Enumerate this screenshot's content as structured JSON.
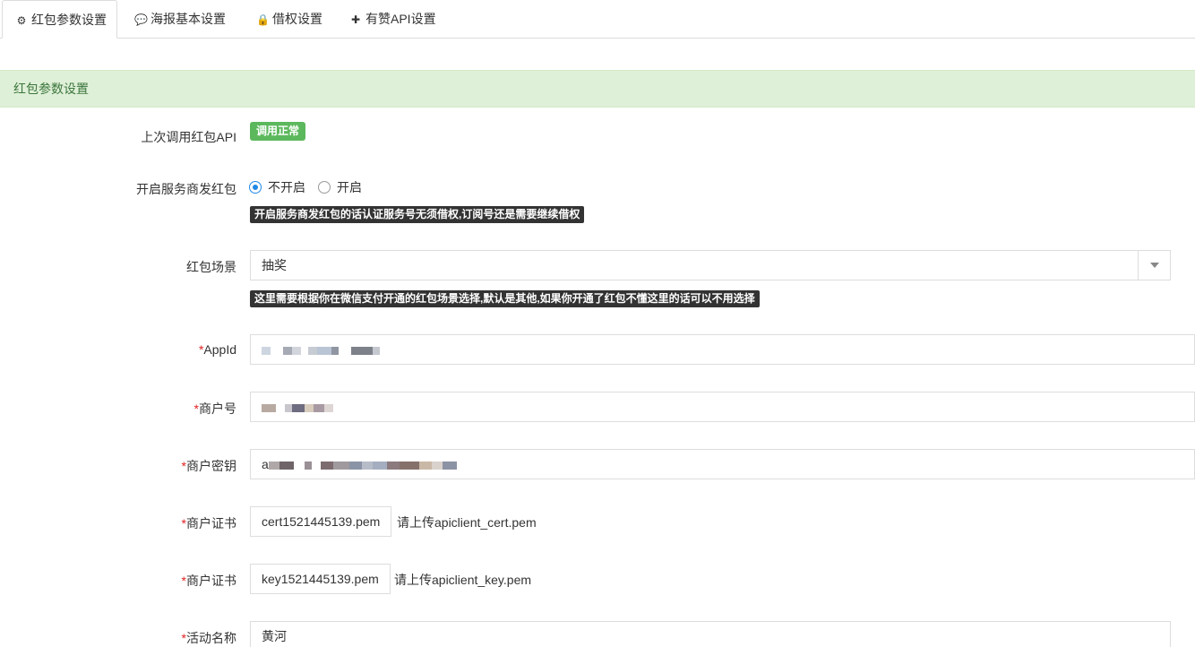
{
  "tabs": [
    {
      "label": "红包参数设置",
      "icon": "gear-icon",
      "glyph": "⚙",
      "active": true
    },
    {
      "label": "海报基本设置",
      "icon": "comments-icon",
      "glyph": "💬",
      "active": false
    },
    {
      "label": "借权设置",
      "icon": "lock-icon",
      "glyph": "🔒",
      "active": false
    },
    {
      "label": "有赞API设置",
      "icon": "plus-icon",
      "glyph": "✚",
      "active": false
    }
  ],
  "panel": {
    "title": "红包参数设置"
  },
  "form": {
    "api_status": {
      "label": "上次调用红包API",
      "badge": "调用正常",
      "badge_color": "#5cb85c"
    },
    "service_redpack": {
      "label": "开启服务商发红包",
      "options": [
        "不开启",
        "开启"
      ],
      "selected": "不开启",
      "hint": "开启服务商发红包的话认证服务号无须借权,订阅号还是需要继续借权"
    },
    "scene": {
      "label": "红包场景",
      "value": "抽奖",
      "hint": "这里需要根据你在微信支付开通的红包场景选择,默认是其他,如果你开通了红包不懂这里的话可以不用选择"
    },
    "appid": {
      "required_mark": "*",
      "label": "AppId"
    },
    "merchant_no": {
      "required_mark": "*",
      "label": "商户号"
    },
    "merchant_key": {
      "required_mark": "*",
      "label": "商户密钥",
      "value_prefix": "a"
    },
    "cert": {
      "required_mark": "*",
      "label": "商户证书",
      "file": "cert1521445139.pem",
      "note": "请上传apiclient_cert.pem"
    },
    "key": {
      "required_mark": "*",
      "label": "商户证书",
      "file": "key1521445139.pem",
      "note": "请上传apiclient_key.pem"
    },
    "activity_name": {
      "required_mark": "*",
      "label": "活动名称",
      "value": "黄河"
    }
  },
  "colors": {
    "accent": "#1e88e5",
    "panel_bg": "#dff0d8",
    "panel_text": "#3c763d",
    "required": "#e02222"
  }
}
